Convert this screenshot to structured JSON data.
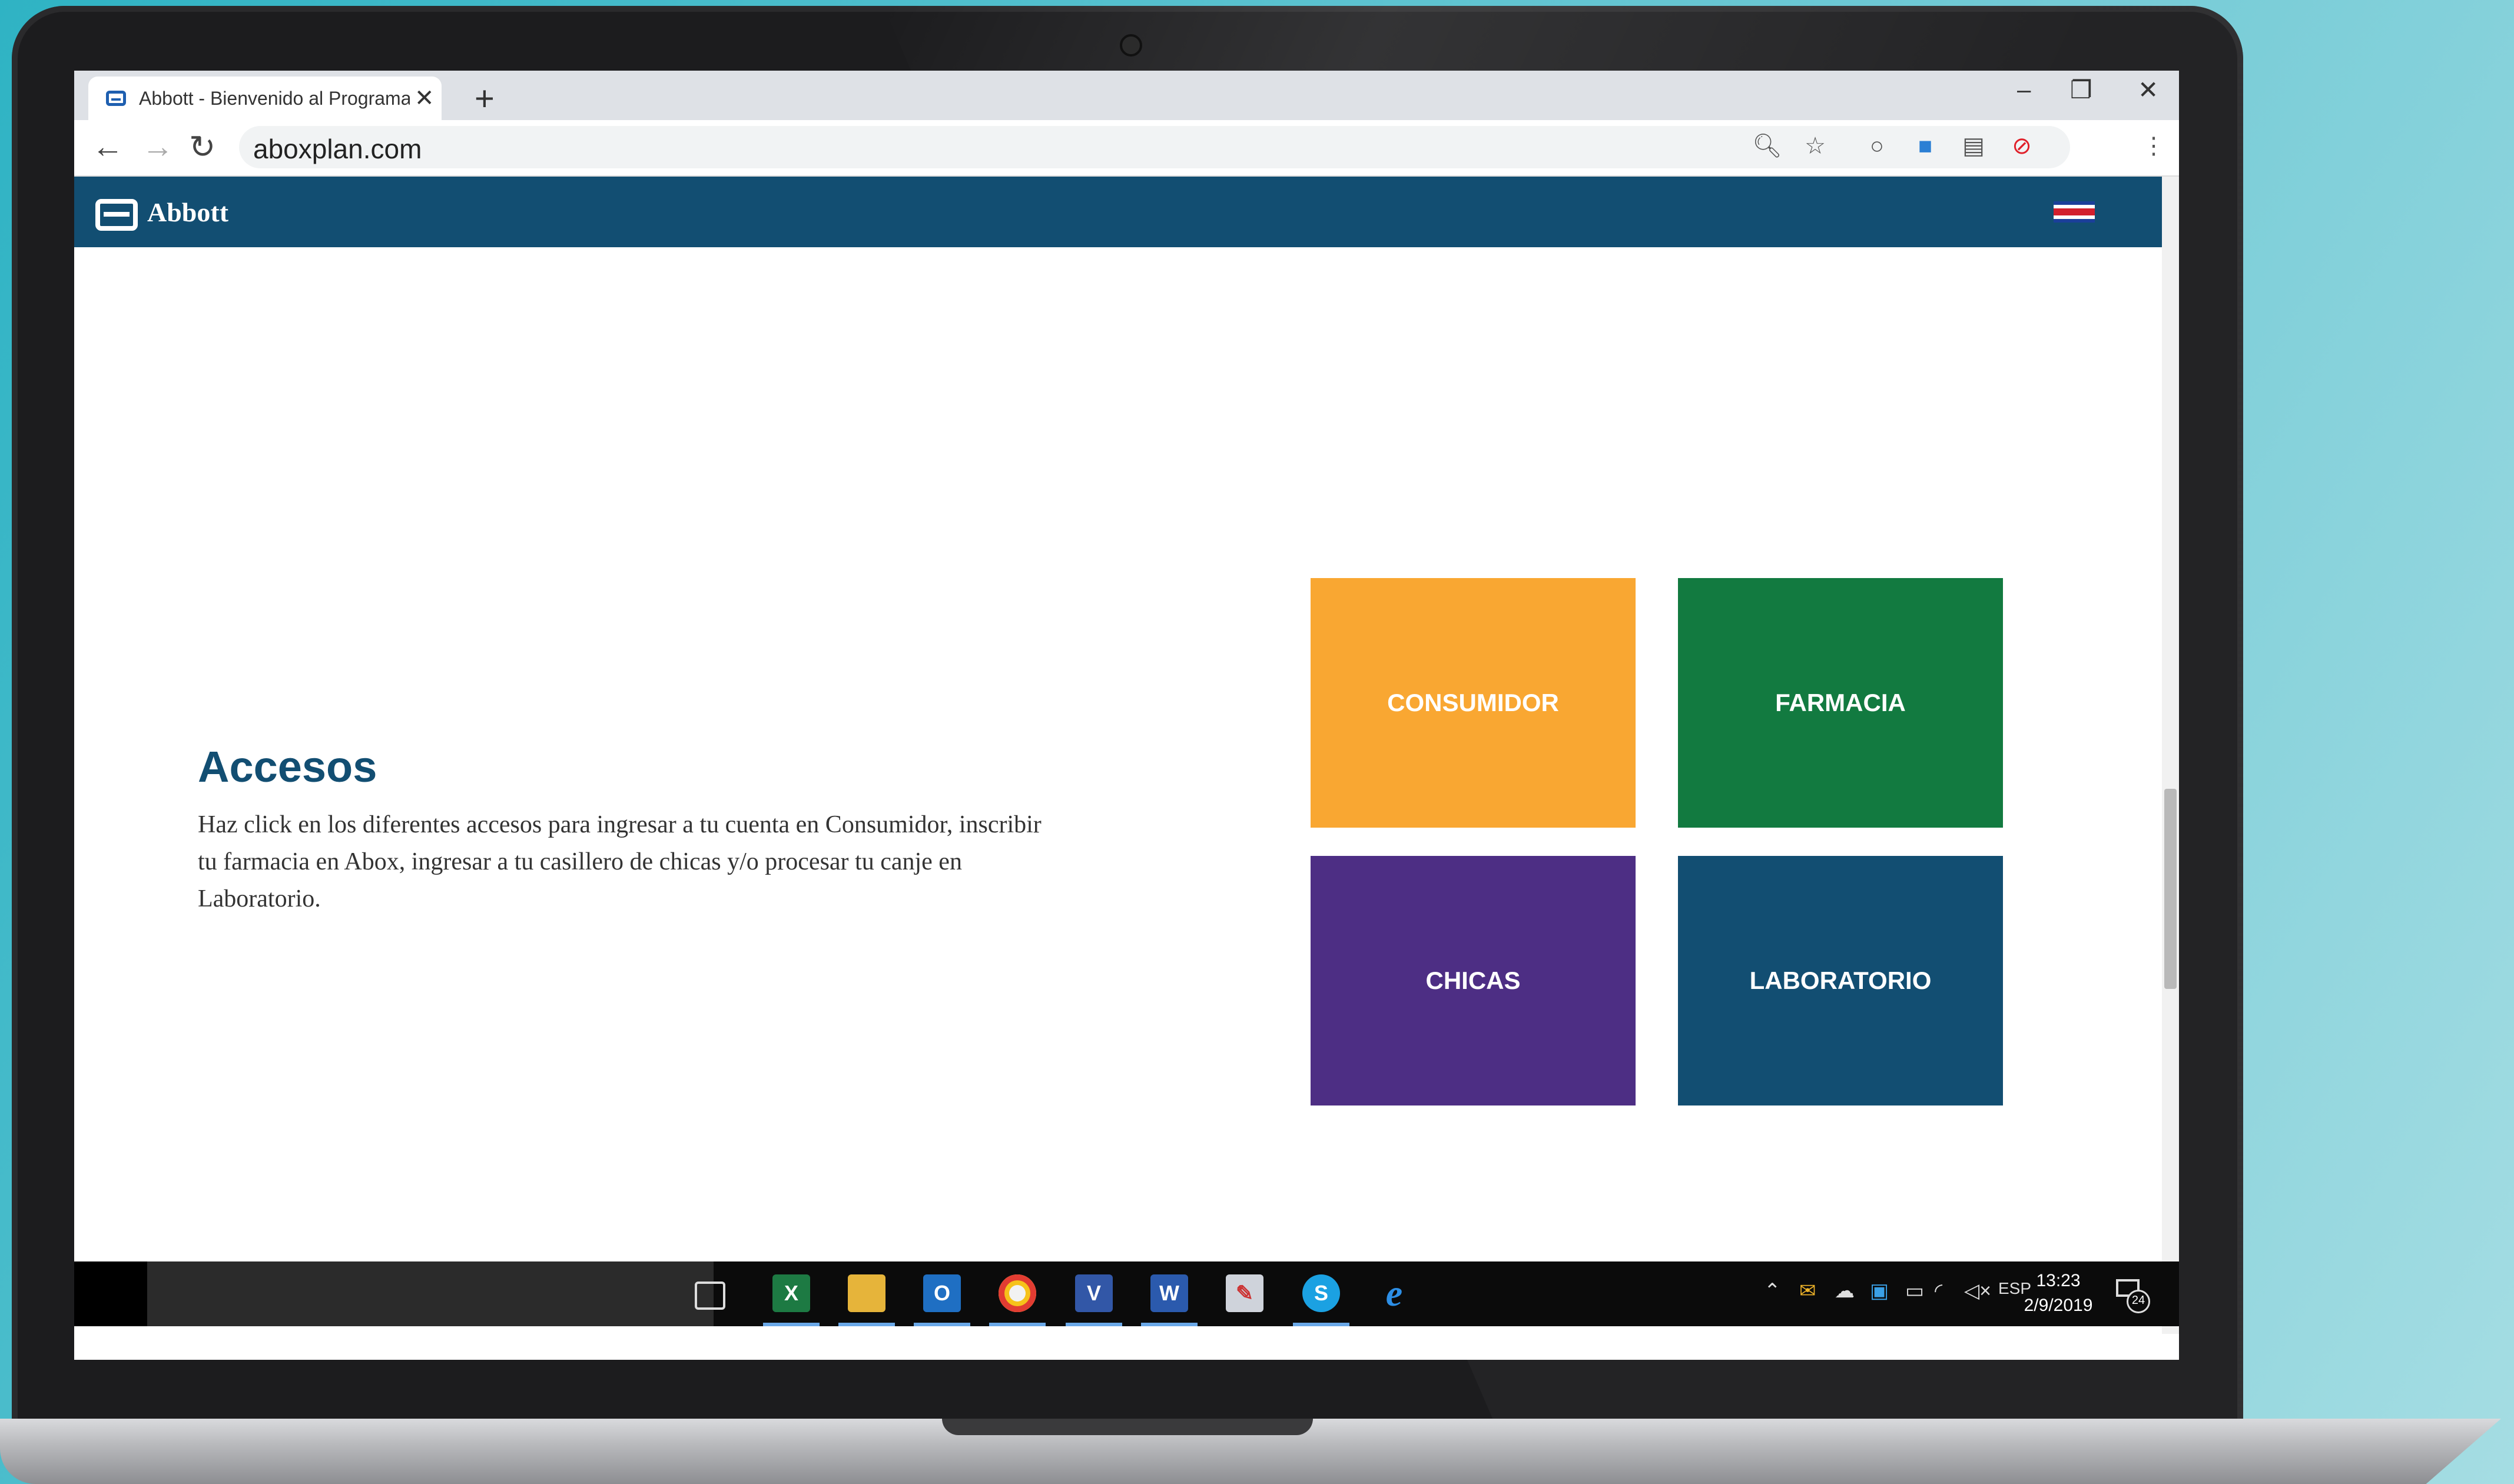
{
  "browser": {
    "tab_title": "Abbott - Bienvenido al Programa",
    "tab_close": "✕",
    "new_tab": "+",
    "minimize": "–",
    "maximize": "❐",
    "close": "✕",
    "url": "aboxplan.com",
    "back": "←",
    "forward": "→",
    "reload": "↻",
    "menu": "⋮"
  },
  "site": {
    "logo_text": "Abbott",
    "flag": "costa-rica-flag",
    "heading": "Accesos",
    "description": "Haz click en los diferentes accesos para ingresar a tu cuenta en Consumidor, inscribir tu farmacia en Abox, ingresar a tu casillero de chicas y/o procesar tu canje en Laboratorio.",
    "tiles": [
      {
        "label": "CONSUMIDOR",
        "color": "#f9a732"
      },
      {
        "label": "FARMACIA",
        "color": "#127a40"
      },
      {
        "label": "CHICAS",
        "color": "#4d2e84"
      },
      {
        "label": "LABORATORIO",
        "color": "#124e72"
      }
    ]
  },
  "taskbar": {
    "apps": [
      {
        "name": "task-view-icon",
        "glyph": "▭"
      },
      {
        "name": "excel-icon",
        "glyph": "X"
      },
      {
        "name": "file-explorer-icon",
        "glyph": "▬"
      },
      {
        "name": "outlook-icon",
        "glyph": "O"
      },
      {
        "name": "chrome-icon",
        "glyph": "◉"
      },
      {
        "name": "visio-icon",
        "glyph": "V"
      },
      {
        "name": "word-icon",
        "glyph": "W"
      },
      {
        "name": "paint-icon",
        "glyph": "✎"
      },
      {
        "name": "skype-icon",
        "glyph": "S"
      },
      {
        "name": "edge-icon",
        "glyph": "e"
      }
    ],
    "tray": {
      "language": "ESP",
      "time": "13:23",
      "date": "2/9/2019",
      "notifications": "24"
    }
  }
}
